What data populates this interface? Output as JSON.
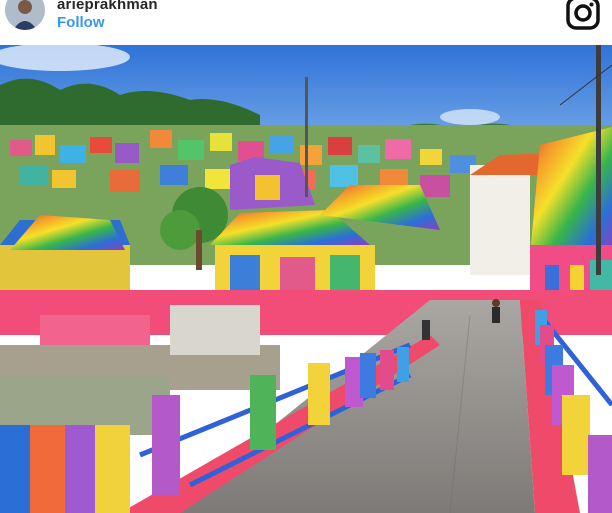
{
  "post": {
    "username": "arieprakhman",
    "follow_label": "Follow"
  },
  "icons": {
    "avatar": "profile-avatar",
    "brand": "instagram-icon"
  },
  "photo": {
    "subject": "rainbow-painted village with bridge railings",
    "colors": {
      "sky": "#3f86e0",
      "road": "#8f8c8a",
      "railing_pink": "#e94f72",
      "river": "#9aa589"
    }
  }
}
